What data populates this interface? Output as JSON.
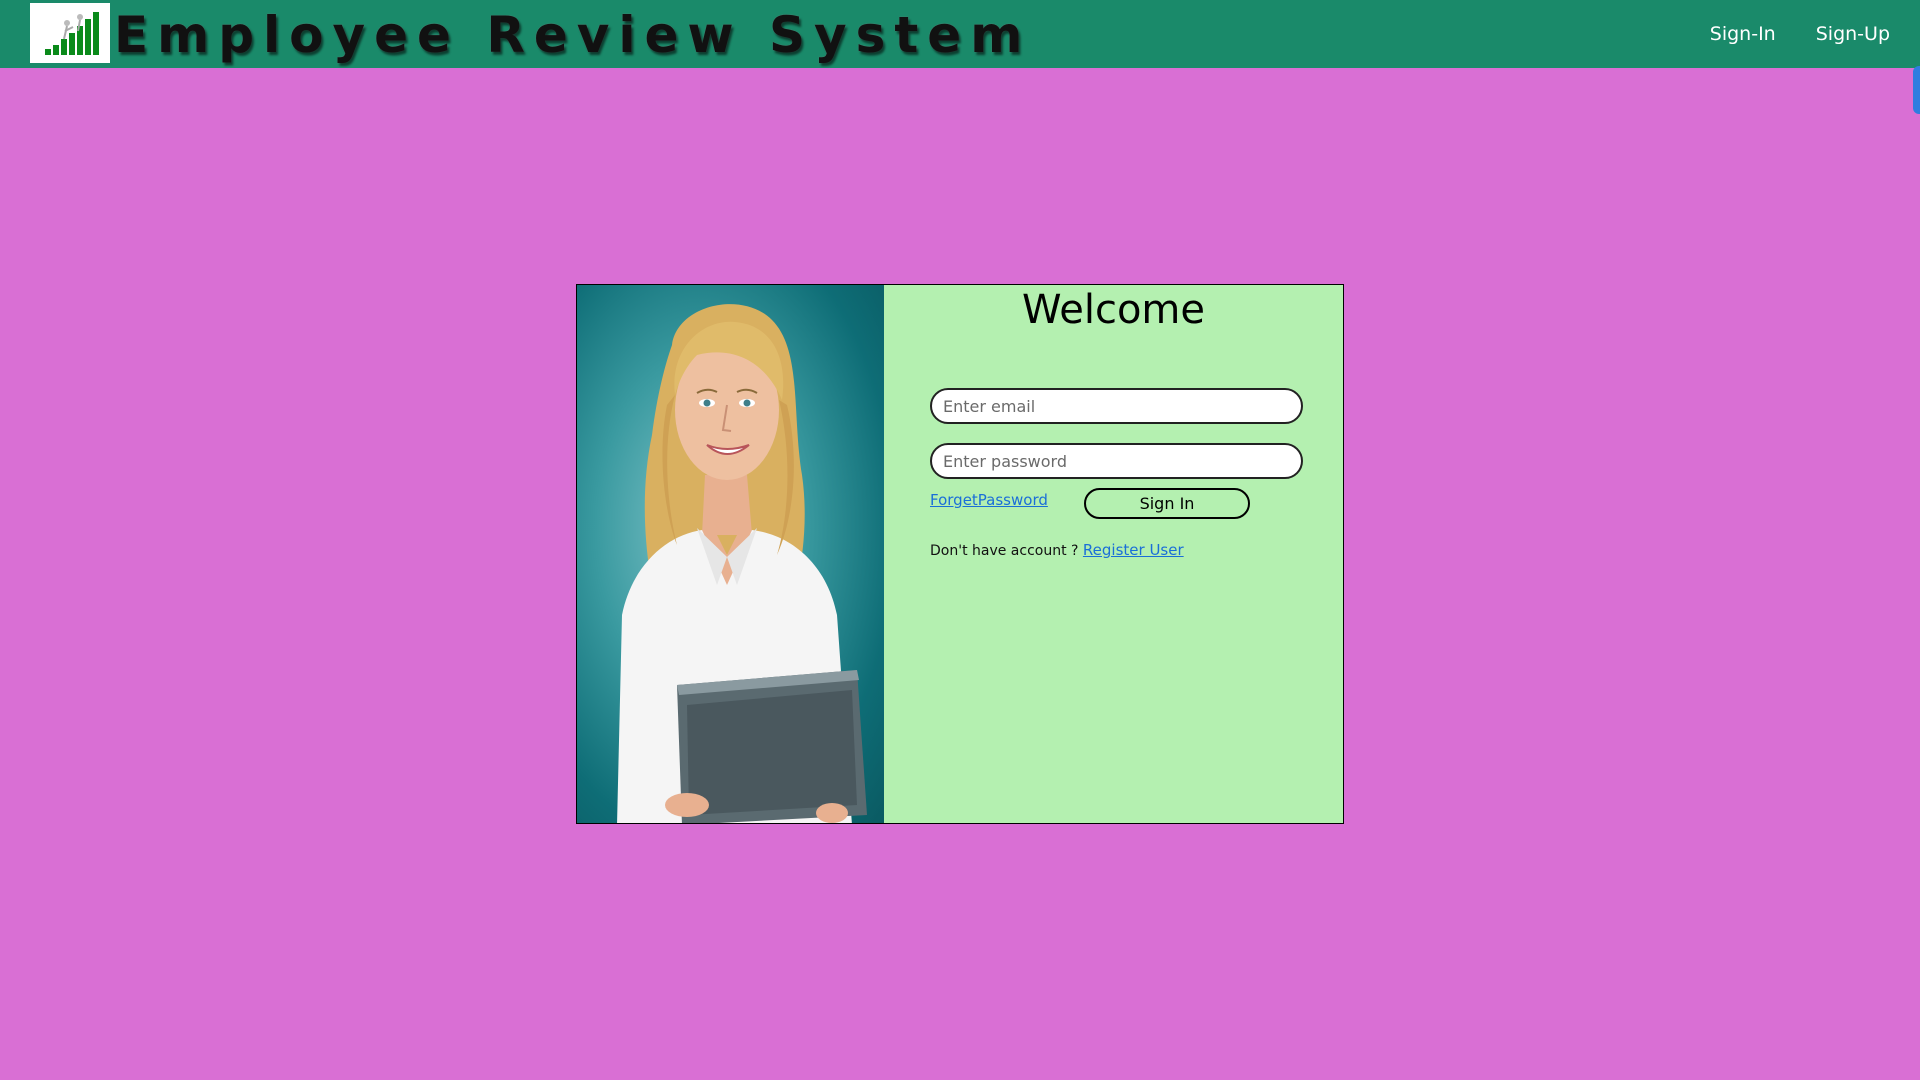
{
  "header": {
    "brand_title": "Employee Review System",
    "nav": [
      {
        "label": "Sign-In"
      },
      {
        "label": "Sign-Up"
      }
    ]
  },
  "login": {
    "welcome": "Welcome",
    "email_placeholder": "Enter email",
    "password_placeholder": "Enter password",
    "forget_password": "ForgetPassword",
    "sign_in_button": "Sign In",
    "no_account_text": "Don't have account ?",
    "register_link": "Register User"
  },
  "colors": {
    "page_background": "#d96fd4",
    "navbar": "#1a8a6a",
    "panel": "#b4f0b0",
    "link": "#1a6ed8"
  },
  "icons": {
    "logo": "growth-chart-logo-icon"
  }
}
